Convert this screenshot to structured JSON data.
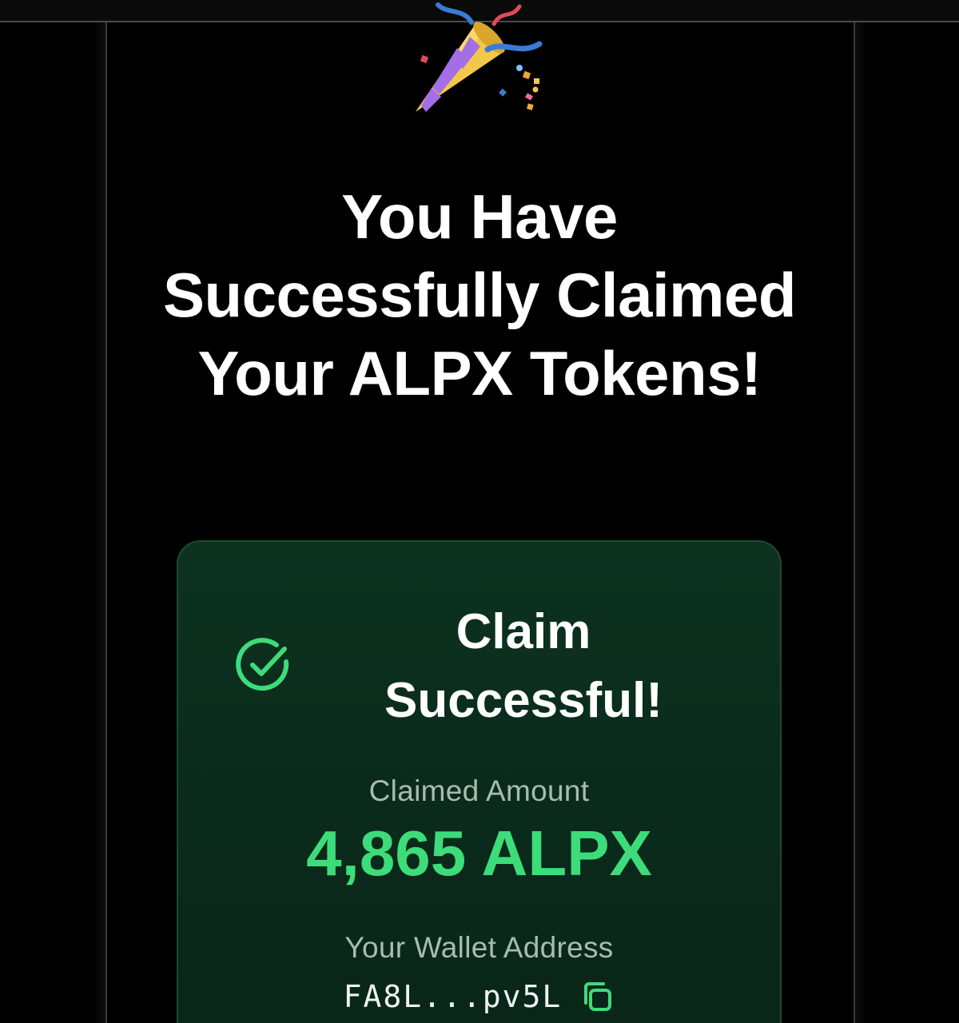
{
  "headline": "You Have Successfully Claimed Your ALPX Tokens!",
  "card": {
    "title": "Claim Successful!",
    "claimed_label": "Claimed Amount",
    "claimed_amount": "4,865 ALPX",
    "wallet_label": "Your Wallet Address",
    "wallet_address": "FA8L...pv5L"
  },
  "icons": {
    "celebration": "party-popper-icon",
    "success": "check-circle-icon",
    "copy": "copy-icon"
  },
  "colors": {
    "background": "#000000",
    "card_background": "#0b2d1d",
    "accent_green": "#3ddc7a",
    "muted_text": "#a8bcae"
  }
}
